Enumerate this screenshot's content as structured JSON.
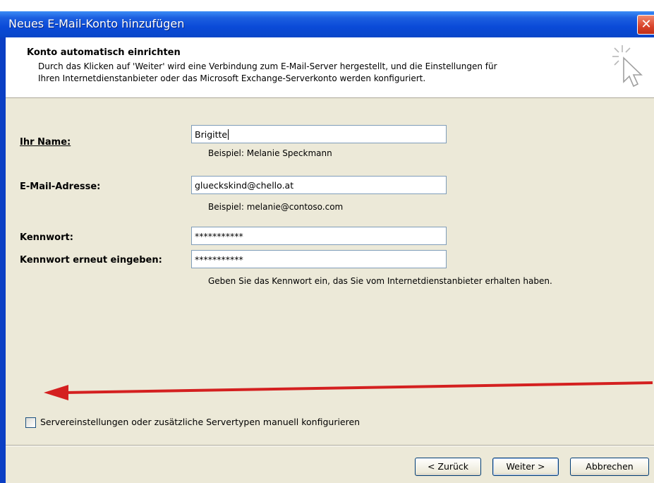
{
  "window": {
    "title": "Neues E-Mail-Konto hinzufügen",
    "close_glyph": "✕"
  },
  "header": {
    "title": "Konto automatisch einrichten",
    "description_line1": "Durch das Klicken auf 'Weiter' wird eine Verbindung zum E-Mail-Server hergestellt, und die Einstellungen für",
    "description_line2": "Ihren Internetdienstanbieter oder das Microsoft Exchange-Serverkonto werden konfiguriert.",
    "icon": "wizard-cursor-icon"
  },
  "form": {
    "name_label": "Ihr Name:",
    "name_value": "Brigitte",
    "name_hint": "Beispiel: Melanie Speckmann",
    "email_label": "E-Mail-Adresse:",
    "email_value": "glueckskind@chello.at",
    "email_hint": "Beispiel: melanie@contoso.com",
    "password_label": "Kennwort:",
    "password_value": "***********",
    "password_repeat_label": "Kennwort erneut eingeben:",
    "password_repeat_value": "***********",
    "password_hint": "Geben Sie das Kennwort ein, das Sie vom Internetdienstanbieter erhalten haben."
  },
  "manual_config": {
    "checked": false,
    "label": "Servereinstellungen oder zusätzliche Servertypen manuell konfigurieren"
  },
  "buttons": {
    "back": "< Zurück",
    "next": "Weiter >",
    "cancel": "Abbrechen"
  },
  "annotation": {
    "arrow_color": "#d42020"
  }
}
